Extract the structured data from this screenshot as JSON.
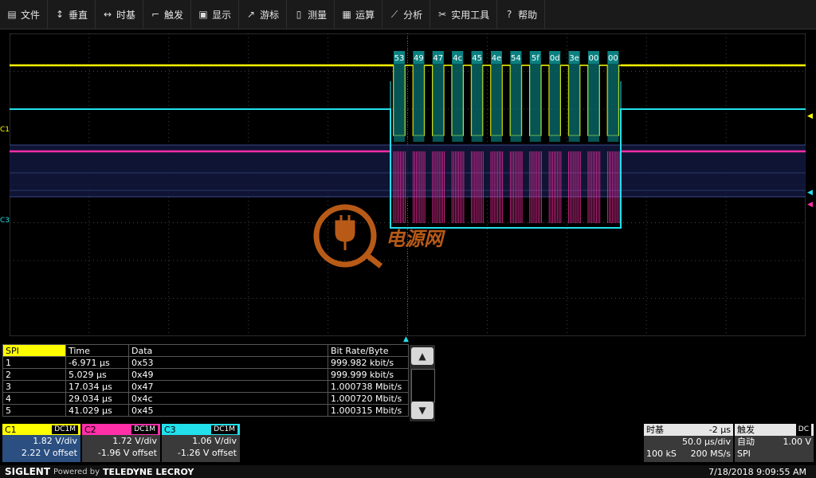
{
  "menu": [
    {
      "icon": "document-icon",
      "glyph": "▤",
      "label": "文件"
    },
    {
      "icon": "vertical-icon",
      "glyph": "↕",
      "label": "垂直"
    },
    {
      "icon": "horizontal-icon",
      "glyph": "↔",
      "label": "时基"
    },
    {
      "icon": "trigger-icon",
      "glyph": "⌐",
      "label": "触发"
    },
    {
      "icon": "display-icon",
      "glyph": "▣",
      "label": "显示"
    },
    {
      "icon": "cursor-icon",
      "glyph": "↗",
      "label": "游标"
    },
    {
      "icon": "measure-icon",
      "glyph": "▯",
      "label": "测量"
    },
    {
      "icon": "math-icon",
      "glyph": "▦",
      "label": "运算"
    },
    {
      "icon": "analysis-icon",
      "glyph": "⟋",
      "label": "分析"
    },
    {
      "icon": "tools-icon",
      "glyph": "✂",
      "label": "实用工具"
    },
    {
      "icon": "help-icon",
      "glyph": "?",
      "label": "帮助"
    }
  ],
  "channel_labels": {
    "c1": "C1",
    "c3": "C3"
  },
  "decode": {
    "bytes": [
      "53",
      "49",
      "47",
      "4c",
      "45",
      "4e",
      "54",
      "5f",
      "0d",
      "3e",
      "00",
      "00"
    ]
  },
  "watermark": {
    "text": "电源网"
  },
  "table": {
    "headers": [
      "SPI",
      "Time",
      "Data",
      "Bit Rate/Byte"
    ],
    "rows": [
      {
        "idx": "1",
        "time": "-6.971 µs",
        "data": "0x53",
        "rate": "999.982 kbit/s"
      },
      {
        "idx": "2",
        "time": "5.029 µs",
        "data": "0x49",
        "rate": "999.999 kbit/s"
      },
      {
        "idx": "3",
        "time": "17.034 µs",
        "data": "0x47",
        "rate": "1.000738 Mbit/s"
      },
      {
        "idx": "4",
        "time": "29.034 µs",
        "data": "0x4c",
        "rate": "1.000720 Mbit/s"
      },
      {
        "idx": "5",
        "time": "41.029 µs",
        "data": "0x45",
        "rate": "1.000315 Mbit/s"
      }
    ]
  },
  "channels": [
    {
      "name": "C1",
      "coupling": "DC1M",
      "vdiv": "1.82 V/div",
      "offset": "2.22 V offset",
      "color": "#ffff00"
    },
    {
      "name": "C2",
      "coupling": "DC1M",
      "vdiv": "1.72 V/div",
      "offset": "-1.96 V offset",
      "color": "#ff2fa8"
    },
    {
      "name": "C3",
      "coupling": "DC1M",
      "vdiv": "1.06 V/div",
      "offset": "-1.26 V offset",
      "color": "#22e0ec"
    }
  ],
  "timebase": {
    "title": "时基",
    "delay": "-2 µs",
    "sdiv": "50.0 µs/div",
    "points": "100 kS",
    "rate": "200 MS/s"
  },
  "trigger": {
    "title": "触发",
    "coupling": "DC",
    "mode": "自动",
    "level": "1.00 V",
    "type": "SPI"
  },
  "footer": {
    "brand": "SIGLENT",
    "powered": "Powered by",
    "maker": "TELEDYNE LECROY",
    "datetime": "7/18/2018 9:09:55 AM"
  },
  "colors": {
    "c1": "#ffff00",
    "c2": "#ff2fa8",
    "c3": "#22e0ec",
    "decode_fill": "#0a7070",
    "watermark": "#d96a1c"
  }
}
